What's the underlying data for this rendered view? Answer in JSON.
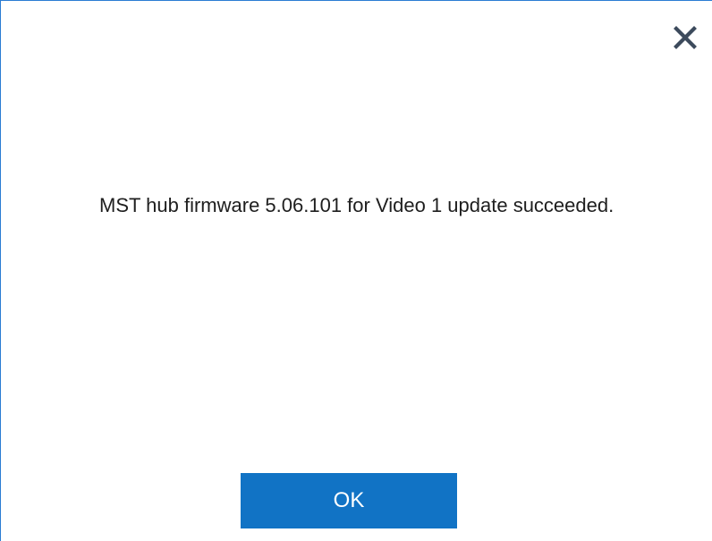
{
  "dialog": {
    "message": "MST hub firmware 5.06.101 for Video 1 update succeeded.",
    "ok_label": "OK",
    "close_icon": "close-icon"
  },
  "colors": {
    "accent": "#1173c5",
    "border": "#2b7cd3",
    "text": "#1e1e1e",
    "background": "#ffffff"
  }
}
